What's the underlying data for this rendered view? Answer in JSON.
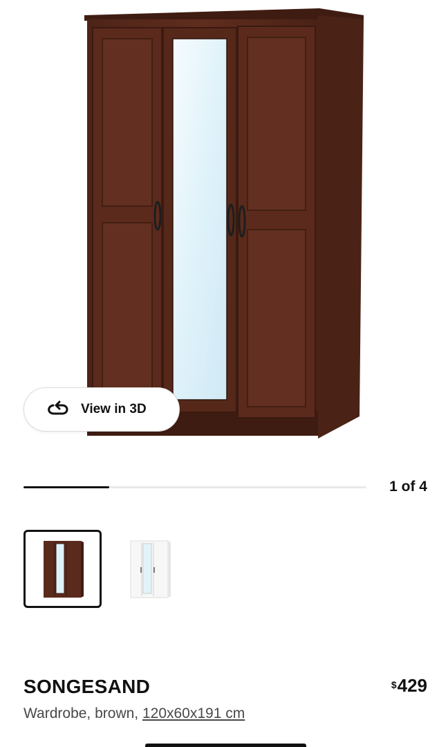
{
  "view3d": {
    "label": "View in 3D",
    "icon": "rotate-3d-icon"
  },
  "carousel": {
    "counter": "1 of 4",
    "progress": 0.25
  },
  "thumbnails": [
    {
      "variant": "brown",
      "selected": true
    },
    {
      "variant": "white",
      "selected": false
    }
  ],
  "product": {
    "name": "SONGESAND",
    "currency_symbol": "$",
    "price": "429",
    "description": "Wardrobe, brown, ",
    "measurement": "120x60x191 cm"
  },
  "colors": {
    "wood": "#5a2a1c",
    "wood_dark": "#3f1c12",
    "mirror": "#dff2fa",
    "text": "#111111",
    "muted_text": "#484848"
  }
}
